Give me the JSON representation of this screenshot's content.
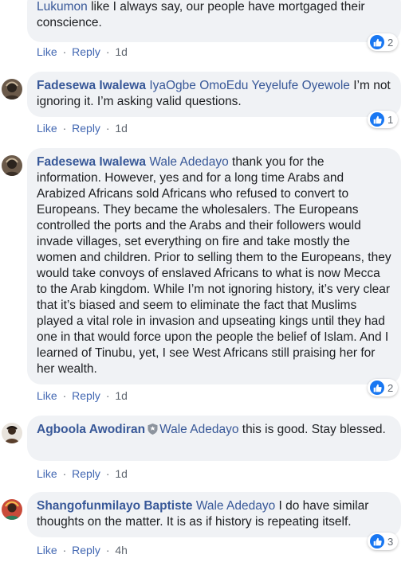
{
  "actions": {
    "like": "Like",
    "reply": "Reply",
    "separator": "·"
  },
  "comments": [
    {
      "name": "",
      "tag": "Lukumon",
      "text": " like I always say, our people have mortgaged their conscience.",
      "time": "1d",
      "reactions": "2"
    },
    {
      "name": "Fadesewa Iwalewa",
      "tag": "IyaOgbe OmoEdu Yeyelufe Oyewole",
      "text": " I’m not ignoring it. I’m asking valid questions.",
      "time": "1d",
      "reactions": "1"
    },
    {
      "name": "Fadesewa Iwalewa",
      "tag": "Wale Adedayo",
      "text": " thank you for the information. However, yes and for a long time Arabs and Arabized Africans sold Africans who refused to convert to Europeans. They became the wholesalers. The Europeans controlled the ports and the Arabs and their followers would invade villages, set everything on fire and take mostly the women and children. Prior to selling them to the Europeans, they would take convoys of enslaved Africans to what is now Mecca to the Arab kingdom. While I’m not ignoring history, it’s very clear that it’s biased and seem to eliminate the fact that Muslims played a vital role in invasion and upseating kings until they had one in that would force upon the people the belief of Islam. And I learned of Tinubu, yet, I see West Africans still praising her for her wealth.",
      "time": "1d",
      "reactions": "2"
    },
    {
      "name": "Agboola Awodiran",
      "tag": "Wale Adedayo",
      "text": " this is good. Stay blessed.",
      "time": "1d",
      "reactions": ""
    },
    {
      "name": "Shangofunmilayo Baptiste",
      "tag": "Wale Adedayo",
      "text": " I do have similar thoughts on the matter. It is as if history is repeating itself.",
      "time": "4h",
      "reactions": "3"
    }
  ]
}
